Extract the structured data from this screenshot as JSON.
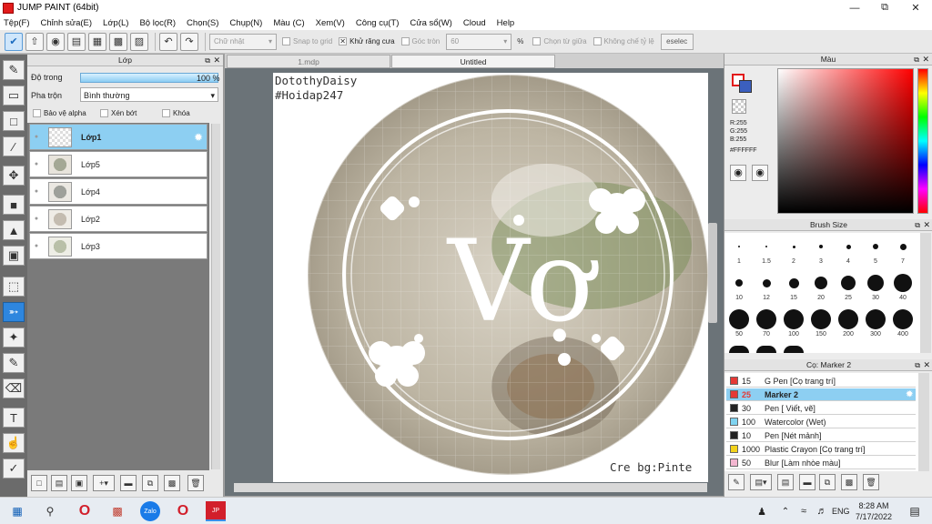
{
  "window": {
    "title": "JUMP PAINT (64bit)"
  },
  "menu": [
    "Tệp(F)",
    "Chỉnh sửa(E)",
    "Lớp(L)",
    "Bộ lọc(R)",
    "Chọn(S)",
    "Chụp(N)",
    "Màu (C)",
    "Xem(V)",
    "Công cụ(T)",
    "Cửa sổ(W)",
    "Cloud",
    "Help"
  ],
  "toolbar": {
    "shape_select": "Chữ nhật",
    "snap_label": "Snap to grid",
    "antialias_label": "Khử răng cưa",
    "corner_label": "Góc tròn",
    "corner_value": "60",
    "percent": "%",
    "from_center_label": "Chọn từ giữa",
    "fixed_ratio_label": "Không chế tỷ lệ",
    "deselect_label": "eselec"
  },
  "layer_panel": {
    "title": "Lớp",
    "opacity_label": "Độ trong",
    "opacity_value": "100 %",
    "blend_label": "Pha trộn",
    "blend_value": "Bình thường",
    "protect_alpha": "Bảo vệ alpha",
    "clip": "Xén bớt",
    "lock": "Khóa",
    "layers": [
      "Lớp1",
      "Lớp5",
      "Lớp4",
      "Lớp2",
      "Lớp3"
    ]
  },
  "tabs": [
    "1.mdp",
    "Untitled"
  ],
  "canvas": {
    "author_text": "DotothyDaisy",
    "hashtag_text": "#Hoidap247",
    "credit_text": "Cre bg:Pinte",
    "main_text": "Vợ"
  },
  "color_panel": {
    "title": "Màu",
    "r": "R:255",
    "g": "G:255",
    "b": "B:255",
    "hex": "#FFFFFF"
  },
  "brush_size_panel": {
    "title": "Brush Size",
    "sizes": [
      "1",
      "1.5",
      "2",
      "3",
      "4",
      "5",
      "7",
      "10",
      "12",
      "15",
      "20",
      "25",
      "30",
      "40",
      "50",
      "70",
      "100",
      "150",
      "200",
      "300",
      "400"
    ]
  },
  "marker_panel": {
    "title": "Cọ: Marker 2",
    "items": [
      {
        "size": "15",
        "name": "G Pen [Cọ trang trí]",
        "color": "#e53935"
      },
      {
        "size": "25",
        "name": "Marker 2",
        "color": "#e53935"
      },
      {
        "size": "30",
        "name": "Pen [ Viết, vẽ]",
        "color": "#222222"
      },
      {
        "size": "100",
        "name": "Watercolor (Wet)",
        "color": "#7fd3f0"
      },
      {
        "size": "10",
        "name": "Pen [Nét mảnh]",
        "color": "#222222"
      },
      {
        "size": "1000",
        "name": "Plastic Crayon [Cọ trang trí]",
        "color": "#f2d21b"
      },
      {
        "size": "50",
        "name": "Blur [Làm nhòe màu]",
        "color": "#f3b6d0"
      }
    ]
  },
  "taskbar": {
    "time": "8:28 AM",
    "date": "7/17/2022",
    "lang": "ENG"
  }
}
